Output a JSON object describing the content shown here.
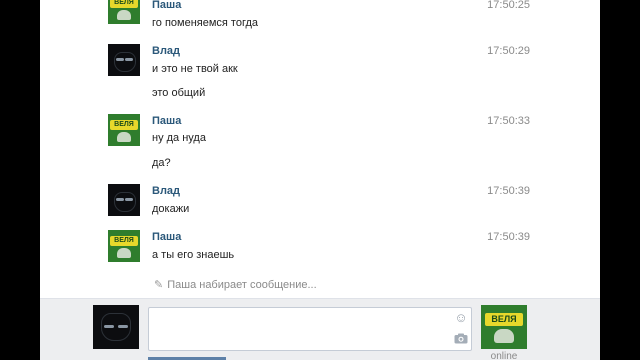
{
  "messages": [
    {
      "author": "Паша",
      "time": "17:50:25",
      "lines": [
        "го поменяемся тогда"
      ]
    },
    {
      "author": "Влад",
      "time": "17:50:29",
      "lines": [
        "и это не твой акк",
        "это общий"
      ]
    },
    {
      "author": "Паша",
      "time": "17:50:33",
      "lines": [
        "ну да нуда",
        "да?"
      ]
    },
    {
      "author": "Влад",
      "time": "17:50:39",
      "lines": [
        "докажи"
      ]
    },
    {
      "author": "Паша",
      "time": "17:50:39",
      "lines": [
        "а ты его знаешь"
      ]
    }
  ],
  "typing_indicator": "Паша набирает сообщение...",
  "composer": {
    "message_value": "",
    "friend_status": "online"
  },
  "icons": {
    "typing": "pencil-icon",
    "emoji": "smile-icon",
    "attach": "camera-icon"
  },
  "colors": {
    "author_name": "#2b587a",
    "send_button": "#5e81a8"
  }
}
